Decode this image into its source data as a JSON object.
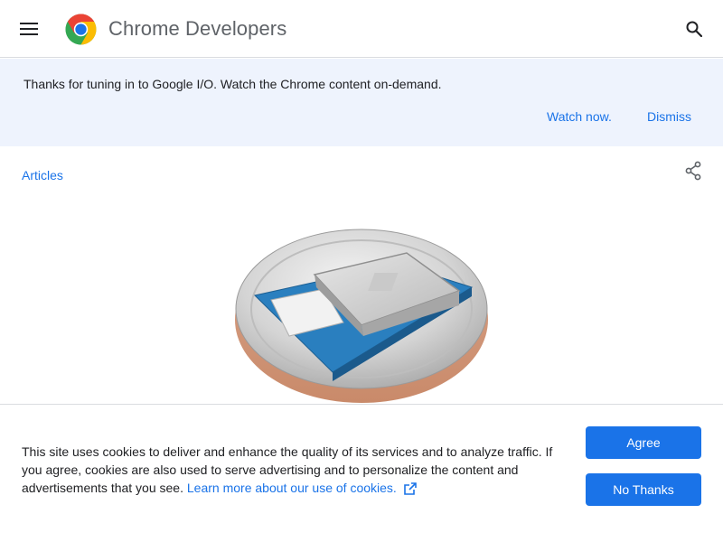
{
  "header": {
    "title": "Chrome Developers",
    "menu_icon": "hamburger-menu-icon",
    "logo_icon": "chrome-logo-icon",
    "search_icon": "search-icon"
  },
  "banner": {
    "text": "Thanks for tuning in to Google I/O. Watch the Chrome content on-demand.",
    "watch_label": "Watch now.",
    "dismiss_label": "Dismiss"
  },
  "breadcrumb": {
    "label": "Articles",
    "share_icon": "share-icon"
  },
  "cookie": {
    "text": "This site uses cookies to deliver and enhance the quality of its services and to analyze traffic. If you agree, cookies are also used to serve advertising and to personalize the content and advertisements that you see.",
    "link_label": "Learn more about our use of cookies.",
    "link_icon": "open-in-new-icon",
    "agree_label": "Agree",
    "no_thanks_label": "No Thanks"
  },
  "colors": {
    "accent": "#1a73e8",
    "banner_bg": "#eef3fd",
    "title_gray": "#5f6368"
  }
}
